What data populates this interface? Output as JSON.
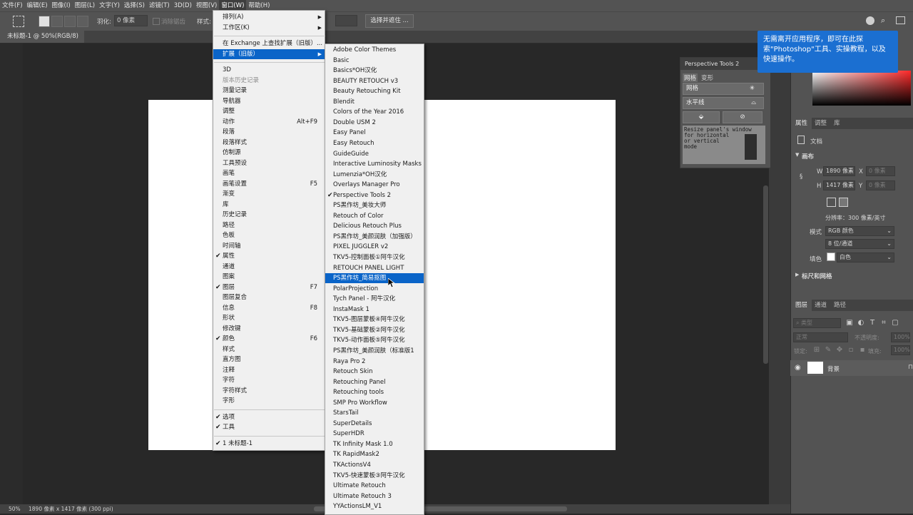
{
  "menubar": {
    "items": [
      "文件(F)",
      "编辑(E)",
      "图像(I)",
      "图层(L)",
      "文字(Y)",
      "选择(S)",
      "滤镜(T)",
      "3D(D)",
      "视图(V)",
      "窗口(W)",
      "帮助(H)"
    ]
  },
  "options": {
    "feather_label": "羽化:",
    "feather_value": "0 像素",
    "antialias_label": "消除锯齿",
    "style_label": "样式:",
    "select_mask": "选择并遮住 ..."
  },
  "document": {
    "tab_title": "未标题-1 @ 50%(RGB/8)",
    "tab_close": "×",
    "zoom": "50%",
    "doc_size": "1890 像素 x 1417 像素 (300 ppi)"
  },
  "tooltip": {
    "text": "无需离开应用程序，即可在此探索\"Photoshop\"工具、实操教程，以及快速操作。"
  },
  "perspective_tools": {
    "title": "Perspective Tools 2",
    "tab1": "网格",
    "tab2": "变形",
    "btn_grid": "网格",
    "btn_horizon": "水平线",
    "hint": "Resize panel's window\nfor horizontal\nor vertical\nmode"
  },
  "window_menu": {
    "items": [
      {
        "label": "排列(A)",
        "arrow": "▶"
      },
      {
        "label": "工作区(K)",
        "arrow": "▶"
      },
      {
        "sep": true
      },
      {
        "label": "在 Exchange 上查找扩展（旧版）..."
      },
      {
        "label": "扩展（旧版）",
        "arrow": "▶",
        "highlight": true
      },
      {
        "sep": true
      },
      {
        "label": "3D"
      },
      {
        "label": "版本历史记录",
        "disabled": true
      },
      {
        "label": "测量记录"
      },
      {
        "label": "导航器"
      },
      {
        "label": "调整"
      },
      {
        "label": "动作",
        "shortcut": "Alt+F9"
      },
      {
        "label": "段落"
      },
      {
        "label": "段落样式"
      },
      {
        "label": "仿制源"
      },
      {
        "label": "工具预设"
      },
      {
        "label": "画笔"
      },
      {
        "label": "画笔设置",
        "shortcut": "F5"
      },
      {
        "label": "渐变"
      },
      {
        "label": "库"
      },
      {
        "label": "历史记录"
      },
      {
        "label": "路径"
      },
      {
        "label": "色板"
      },
      {
        "label": "时间轴"
      },
      {
        "label": "属性",
        "checked": true
      },
      {
        "label": "通道"
      },
      {
        "label": "图案"
      },
      {
        "label": "图层",
        "checked": true,
        "shortcut": "F7"
      },
      {
        "label": "图层复合"
      },
      {
        "label": "信息",
        "shortcut": "F8"
      },
      {
        "label": "形状"
      },
      {
        "label": "修改键"
      },
      {
        "label": "颜色",
        "checked": true,
        "shortcut": "F6"
      },
      {
        "label": "样式"
      },
      {
        "label": "直方图"
      },
      {
        "label": "注释"
      },
      {
        "label": "字符"
      },
      {
        "label": "字符样式"
      },
      {
        "label": "字形"
      },
      {
        "sep": true
      },
      {
        "label": "选项",
        "checked": true
      },
      {
        "label": "工具",
        "checked": true
      },
      {
        "sep": true
      },
      {
        "label": "1 未标题-1",
        "checked": true
      }
    ]
  },
  "extensions_menu": {
    "items": [
      {
        "label": "Adobe Color Themes"
      },
      {
        "label": "Basic"
      },
      {
        "label": "Basics*OH汉化"
      },
      {
        "label": "BEAUTY RETOUCH v3"
      },
      {
        "label": "Beauty Retouching Kit"
      },
      {
        "label": "Blendit"
      },
      {
        "label": "Colors of the Year 2016"
      },
      {
        "label": "Double USM 2"
      },
      {
        "label": "Easy Panel"
      },
      {
        "label": "Easy Retouch"
      },
      {
        "label": "GuideGuide"
      },
      {
        "label": "Interactive Luminosity Masks"
      },
      {
        "label": "Lumenzia*OH汉化"
      },
      {
        "label": "Overlays Manager Pro"
      },
      {
        "label": "Perspective Tools 2",
        "checked": true
      },
      {
        "label": "PS黑作坊_美妆大师"
      },
      {
        "label": "Retouch of Color"
      },
      {
        "label": "Delicious Retouch Plus"
      },
      {
        "label": "PS黑作坊_美颜润肤（加强版）"
      },
      {
        "label": "PIXEL JUGGLER v2"
      },
      {
        "label": "TKV5-控制面板①阿牛汉化"
      },
      {
        "label": "RETOUCH PANEL LIGHT"
      },
      {
        "label": "PS黑作坊_简易抠图",
        "highlight": true
      },
      {
        "label": "PolarProjection"
      },
      {
        "label": "Tych Panel - 阿牛汉化"
      },
      {
        "label": "InstaMask 1"
      },
      {
        "label": "TKV5-图层蒙板④阿牛汉化"
      },
      {
        "label": "TKV5-基础蒙板②阿牛汉化"
      },
      {
        "label": "TKV5-动作面板⑤阿牛汉化"
      },
      {
        "label": "PS黑作坊_美颜润肤（标准版1"
      },
      {
        "label": "Raya Pro 2"
      },
      {
        "label": "Retouch Skin"
      },
      {
        "label": "Retouching Panel"
      },
      {
        "label": "Retouching tools"
      },
      {
        "label": "SMP Pro Workflow"
      },
      {
        "label": "StarsTail"
      },
      {
        "label": "SuperDetails"
      },
      {
        "label": "SuperHDR"
      },
      {
        "label": "TK Infinity Mask 1.0"
      },
      {
        "label": "TK RapidMask2"
      },
      {
        "label": "TKActionsV4"
      },
      {
        "label": "TKV5-快速蒙板③阿牛汉化"
      },
      {
        "label": "Ultimate Retouch"
      },
      {
        "label": "Ultimate Retouch 3"
      },
      {
        "label": "YYActionsLM_V1"
      }
    ]
  },
  "properties_panel": {
    "tabs": [
      "属性",
      "调整",
      "库"
    ],
    "doc_label": "文档",
    "canvas_section": "画布",
    "w_label": "W",
    "w_value": "1890 像素",
    "x_label": "X",
    "x_placeholder": "0 像素",
    "h_label": "H",
    "h_value": "1417 像素",
    "y_label": "Y",
    "y_placeholder": "0 像素",
    "resolution": "分辨率：300 像素/英寸",
    "mode_label": "模式",
    "mode_value": "RGB 颜色",
    "depth_value": "8 位/通道",
    "fill_label": "填色",
    "fill_value": "白色",
    "rulers_section": "标尺和网格"
  },
  "layers_panel": {
    "tabs": [
      "图层",
      "通道",
      "路径"
    ],
    "kind_placeholder": "类型",
    "blend_mode": "正常",
    "opacity_label": "不透明度:",
    "opacity_value": "100%",
    "lock_label": "锁定:",
    "fill_label": "填充:",
    "fill_value": "100%",
    "layer_name": "背景"
  }
}
